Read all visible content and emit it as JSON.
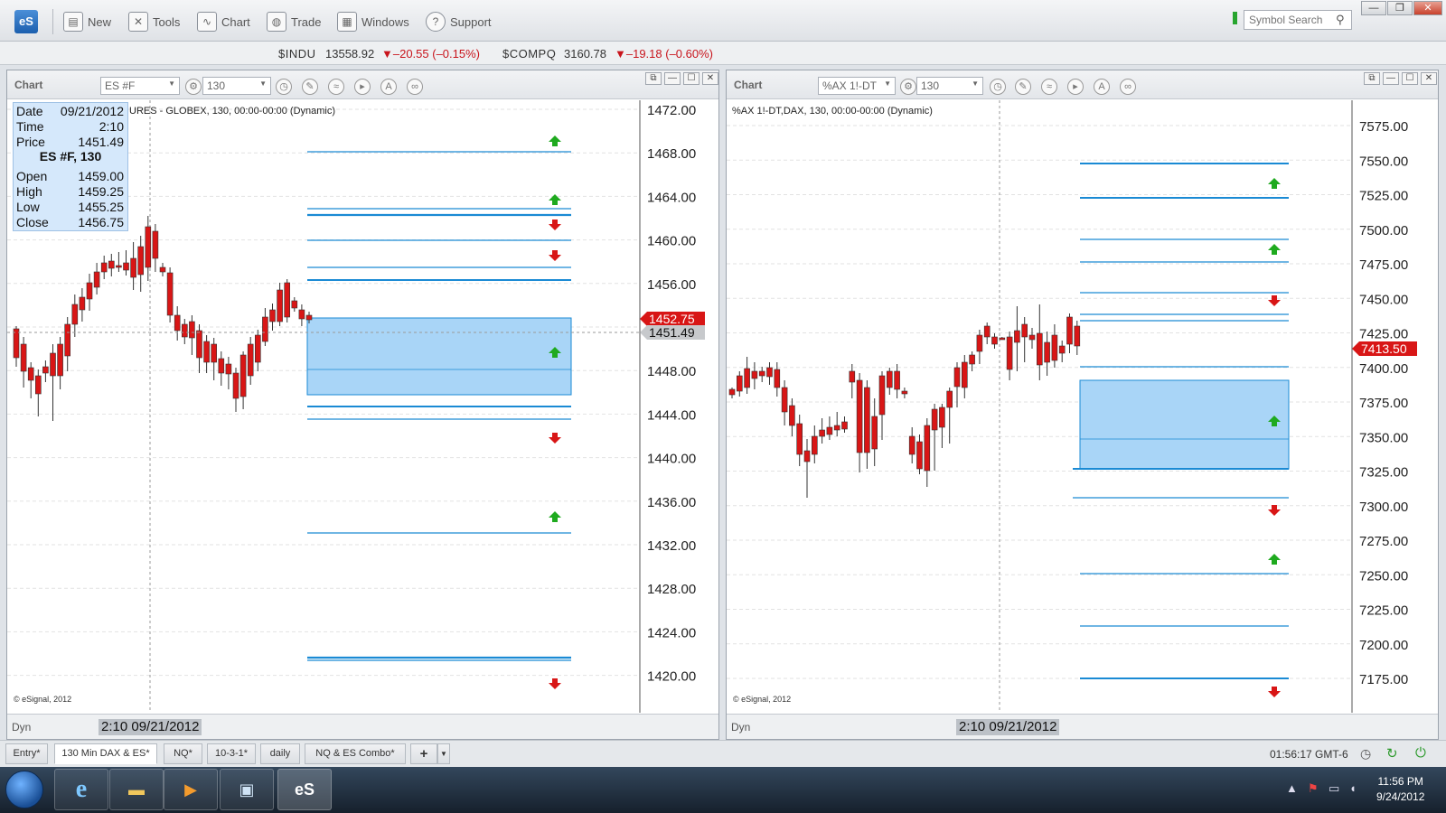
{
  "toolbar": {
    "logo": "eS",
    "items": [
      {
        "name": "new",
        "label": "New",
        "icon": "new-document-icon",
        "glyph": "▤"
      },
      {
        "name": "tools",
        "label": "Tools",
        "icon": "wrench-icon",
        "glyph": "✕"
      },
      {
        "name": "chart",
        "label": "Chart",
        "icon": "chart-icon",
        "glyph": "∿"
      },
      {
        "name": "trade",
        "label": "Trade",
        "icon": "trade-globe-icon",
        "glyph": "◍"
      },
      {
        "name": "windows",
        "label": "Windows",
        "icon": "windows-icon",
        "glyph": "▦"
      },
      {
        "name": "support",
        "label": "Support",
        "icon": "help-icon",
        "glyph": "?"
      }
    ],
    "search_placeholder": "Symbol Search"
  },
  "ticker": [
    {
      "symbol": "$INDU",
      "value": "13558.92",
      "change": "▼–20.55 (–0.15%)"
    },
    {
      "symbol": "$COMPQ",
      "value": "3160.78",
      "change": "▼–19.18 (–0.60%)"
    }
  ],
  "charts": {
    "left": {
      "title": "Chart",
      "symbol": "ES #F",
      "interval": "130",
      "header_text": "URES - GLOBEX, 130, 00:00-00:00 (Dynamic)",
      "copyright": "© eSignal, 2012",
      "footer_mode": "Dyn",
      "footer_time": "2:10 09/21/2012",
      "y_ticks": [
        "1472.00",
        "1468.00",
        "1464.00",
        "1460.00",
        "1456.00",
        "1452.00",
        "1448.00",
        "1444.00",
        "1440.00",
        "1436.00",
        "1432.00",
        "1428.00",
        "1424.00",
        "1420.00"
      ],
      "last_price_red": "1452.75",
      "last_price_grey": "1451.49",
      "infobox": {
        "rows": [
          [
            "Date",
            "09/21/2012"
          ],
          [
            "Time",
            "2:10"
          ],
          [
            "Price",
            "1451.49"
          ]
        ],
        "title": "ES #F, 130",
        "ohlc": [
          [
            "Open",
            "1459.00"
          ],
          [
            "High",
            "1459.25"
          ],
          [
            "Low",
            "1455.25"
          ],
          [
            "Close",
            "1456.75"
          ]
        ]
      }
    },
    "right": {
      "title": "Chart",
      "symbol": "%AX 1!-DT",
      "interval": "130",
      "header_text": "%AX 1!-DT,DAX, 130, 00:00-00:00 (Dynamic)",
      "copyright": "© eSignal, 2012",
      "footer_mode": "Dyn",
      "footer_time": "2:10 09/21/2012",
      "y_ticks": [
        "7575.00",
        "7550.00",
        "7525.00",
        "7500.00",
        "7475.00",
        "7450.00",
        "7425.00",
        "7400.00",
        "7375.00",
        "7350.00",
        "7325.00",
        "7300.00",
        "7275.00",
        "7250.00",
        "7225.00",
        "7200.00",
        "7175.00"
      ],
      "last_price_red": "7413.50"
    }
  },
  "tabs": [
    "Entry*",
    "130 Min DAX & ES*",
    "NQ*",
    "10-3-1*",
    "daily",
    "NQ & ES Combo*",
    "+"
  ],
  "status_time": "01:56:17 GMT-6",
  "taskbar": {
    "time": "11:56 PM",
    "date": "9/24/2012"
  },
  "colors": {
    "up": "#1faa1f",
    "down": "#d81616",
    "level_line": "#1a8ad4",
    "zone_fill": "#a9d5f7"
  }
}
